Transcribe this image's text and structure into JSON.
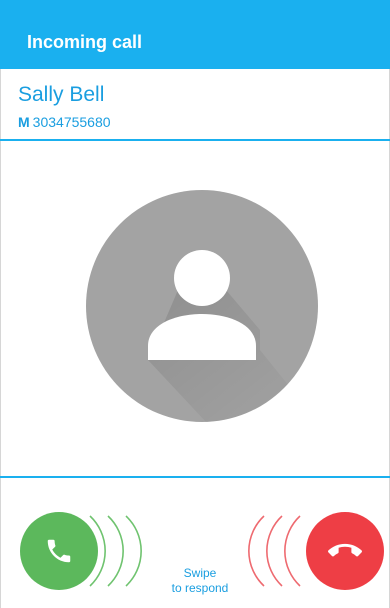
{
  "header": {
    "title": "Incoming call"
  },
  "caller": {
    "name": "Sally Bell",
    "number_type": "M",
    "number": "3034755680"
  },
  "avatar": {
    "icon": "person-icon",
    "background": "#a3a3a3"
  },
  "controls": {
    "swipe_line1": "Swipe",
    "swipe_line2": "to respond",
    "answer_icon": "phone-answer-icon",
    "decline_icon": "phone-hangup-icon"
  },
  "colors": {
    "accent": "#1ab0ef",
    "answer": "#5cb85c",
    "decline": "#ee3e45"
  }
}
